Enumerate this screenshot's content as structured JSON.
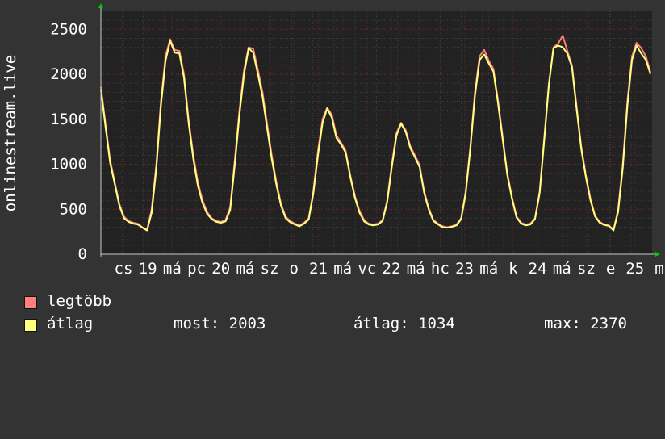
{
  "chart_data": {
    "type": "line",
    "ylabel": "onlinestream.live",
    "ylim": [
      0,
      2700
    ],
    "yticks": [
      0,
      500,
      1000,
      1500,
      2000,
      2500
    ],
    "grid": true,
    "x_tick_labels": [
      "cs",
      "19",
      "má",
      "pc",
      "20",
      "má",
      "sz",
      "o",
      "21",
      "má",
      "vc",
      "22",
      "má",
      "hc",
      "23",
      "má",
      "k",
      "24",
      "má",
      "sz",
      "e",
      "25",
      "m"
    ],
    "series": [
      {
        "name": "legtöbb",
        "color": "#ff7f7f",
        "values": [
          1860,
          1450,
          1050,
          800,
          560,
          420,
          370,
          350,
          340,
          300,
          270,
          500,
          1000,
          1700,
          2200,
          2390,
          2270,
          2260,
          2000,
          1500,
          1100,
          800,
          600,
          470,
          400,
          370,
          360,
          380,
          520,
          1050,
          1600,
          2050,
          2300,
          2280,
          2050,
          1800,
          1450,
          1100,
          800,
          560,
          420,
          370,
          340,
          320,
          350,
          400,
          700,
          1150,
          1500,
          1630,
          1550,
          1320,
          1240,
          1150,
          880,
          650,
          480,
          380,
          340,
          330,
          340,
          380,
          600,
          1000,
          1350,
          1460,
          1380,
          1200,
          1100,
          990,
          700,
          510,
          380,
          340,
          310,
          300,
          310,
          330,
          400,
          700,
          1200,
          1800,
          2200,
          2270,
          2150,
          2060,
          1700,
          1300,
          900,
          640,
          420,
          350,
          330,
          340,
          400,
          700,
          1300,
          1900,
          2300,
          2340,
          2430,
          2260,
          2100,
          1650,
          1200,
          880,
          620,
          430,
          360,
          330,
          320,
          270,
          500,
          1000,
          1700,
          2200,
          2350,
          2290,
          2200,
          2020
        ]
      },
      {
        "name": "átlag",
        "color": "#ffff80",
        "values": [
          1830,
          1420,
          1020,
          780,
          540,
          400,
          360,
          340,
          330,
          295,
          265,
          460,
          950,
          1650,
          2150,
          2370,
          2240,
          2230,
          1960,
          1460,
          1060,
          760,
          570,
          450,
          390,
          360,
          350,
          365,
          490,
          1000,
          1550,
          2000,
          2290,
          2240,
          2000,
          1750,
          1400,
          1060,
          770,
          540,
          400,
          355,
          330,
          310,
          340,
          385,
          670,
          1100,
          1460,
          1620,
          1520,
          1290,
          1220,
          1130,
          860,
          630,
          460,
          365,
          330,
          320,
          330,
          370,
          580,
          970,
          1320,
          1450,
          1360,
          1180,
          1080,
          970,
          680,
          495,
          370,
          330,
          300,
          295,
          305,
          320,
          390,
          680,
          1170,
          1760,
          2160,
          2220,
          2120,
          2030,
          1670,
          1270,
          880,
          620,
          410,
          340,
          320,
          330,
          390,
          680,
          1270,
          1880,
          2290,
          2320,
          2300,
          2230,
          2080,
          1620,
          1170,
          860,
          600,
          420,
          350,
          325,
          315,
          265,
          470,
          960,
          1650,
          2160,
          2320,
          2230,
          2160,
          2003
        ]
      }
    ]
  },
  "legend": {
    "items": [
      {
        "label": "legtöbb",
        "color": "#ff7f7f"
      },
      {
        "label": "átlag",
        "color": "#ffff80"
      }
    ],
    "stats": {
      "now": "most: 2003",
      "avg": "átlag: 1034",
      "max": "max: 2370"
    }
  },
  "colors": {
    "background": "#333333",
    "plot_background": "#222222",
    "grid_major": "#7a2a2a",
    "grid_minor": "#3f3f3f",
    "axis": "#c8c8c8",
    "arrow": "#00cc00"
  }
}
